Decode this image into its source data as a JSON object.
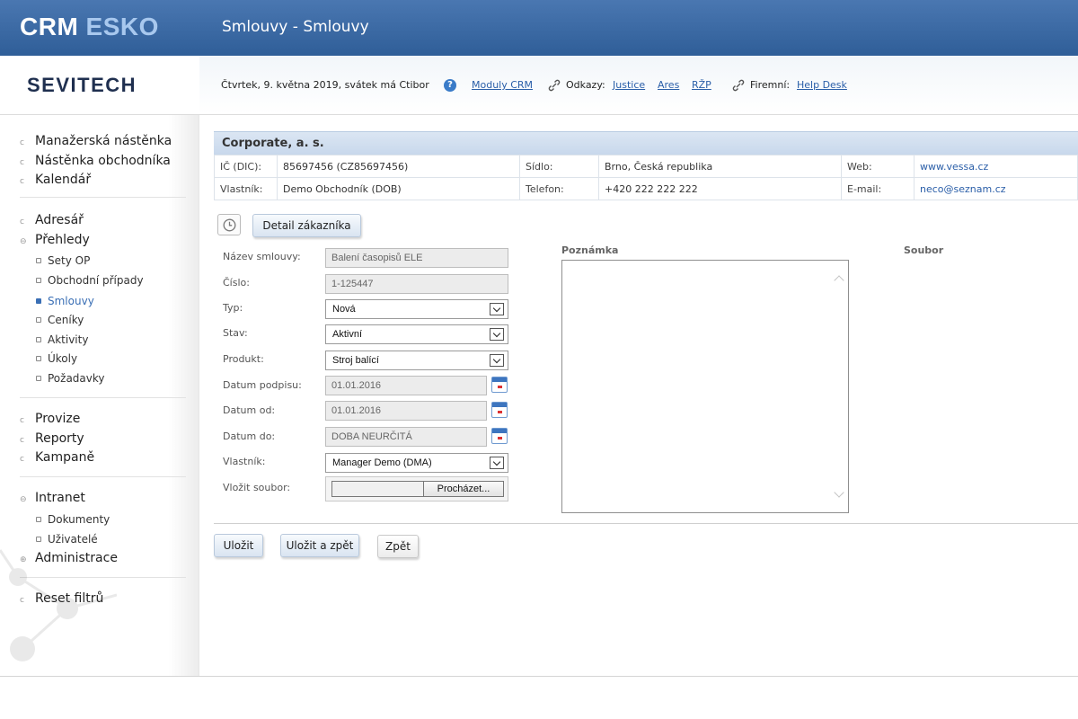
{
  "brand": {
    "part1": "CRM",
    "part2": "ESKO"
  },
  "page_title": "Smlouvy - Smlouvy",
  "logo_text": "SEVITECH",
  "subbar": {
    "date_text": "Čtvrtek, 9. května 2019, svátek má Ctibor",
    "help_link": "Moduly CRM",
    "links_label": "Odkazy:",
    "links": [
      "Justice",
      "Ares",
      "RŽP"
    ],
    "company_label": "Firemní:",
    "company_link": "Help Desk"
  },
  "sidebar": {
    "group1": [
      "Manažerská nástěnka",
      "Nástěnka obchodníka",
      "Kalendář"
    ],
    "adresar": "Adresář",
    "prehledy": "Přehledy",
    "prehledy_items": [
      "Sety OP",
      "Obchodní případy",
      "Smlouvy",
      "Ceníky",
      "Aktivity",
      "Úkoly",
      "Požadavky"
    ],
    "group3": [
      "Provize",
      "Reporty",
      "Kampaně"
    ],
    "intranet": "Intranet",
    "intranet_items": [
      "Dokumenty",
      "Uživatelé"
    ],
    "administrace": "Administrace",
    "reset": "Reset filtrů"
  },
  "customer": {
    "name": "Corporate, a. s.",
    "rows": [
      {
        "l1": "IČ (DIC):",
        "v1": "85697456 (CZ85697456)",
        "l2": "Sídlo:",
        "v2": "Brno, Česká republika",
        "l3": "Web:",
        "v3": "www.vessa.cz"
      },
      {
        "l1": "Vlastník:",
        "v1": "Demo Obchodník (DOB)",
        "l2": "Telefon:",
        "v2": "+420 222 222 222",
        "l3": "E-mail:",
        "v3": "neco@seznam.cz"
      }
    ]
  },
  "detail_button": "Detail zákazníka",
  "form": {
    "nazev_label": "Název smlouvy:",
    "nazev_value": "Balení časopisů ELE",
    "cislo_label": "Číslo:",
    "cislo_value": "1-125447",
    "typ_label": "Typ:",
    "typ_value": "Nová",
    "stav_label": "Stav:",
    "stav_value": "Aktivní",
    "produkt_label": "Produkt:",
    "produkt_value": "Stroj balící",
    "podpis_label": "Datum podpisu:",
    "podpis_value": "01.01.2016",
    "od_label": "Datum od:",
    "od_value": "01.01.2016",
    "do_label": "Datum do:",
    "do_value": "DOBA NEURČITÁ",
    "vlastnik_label": "Vlastník:",
    "vlastnik_value": "Manager Demo (DMA)",
    "soubor_label": "Vložit soubor:",
    "browse_label": "Procházet..."
  },
  "note_label": "Poznámka",
  "file_label": "Soubor",
  "buttons": {
    "save": "Uložit",
    "save_back": "Uložit a zpět",
    "back": "Zpět"
  }
}
